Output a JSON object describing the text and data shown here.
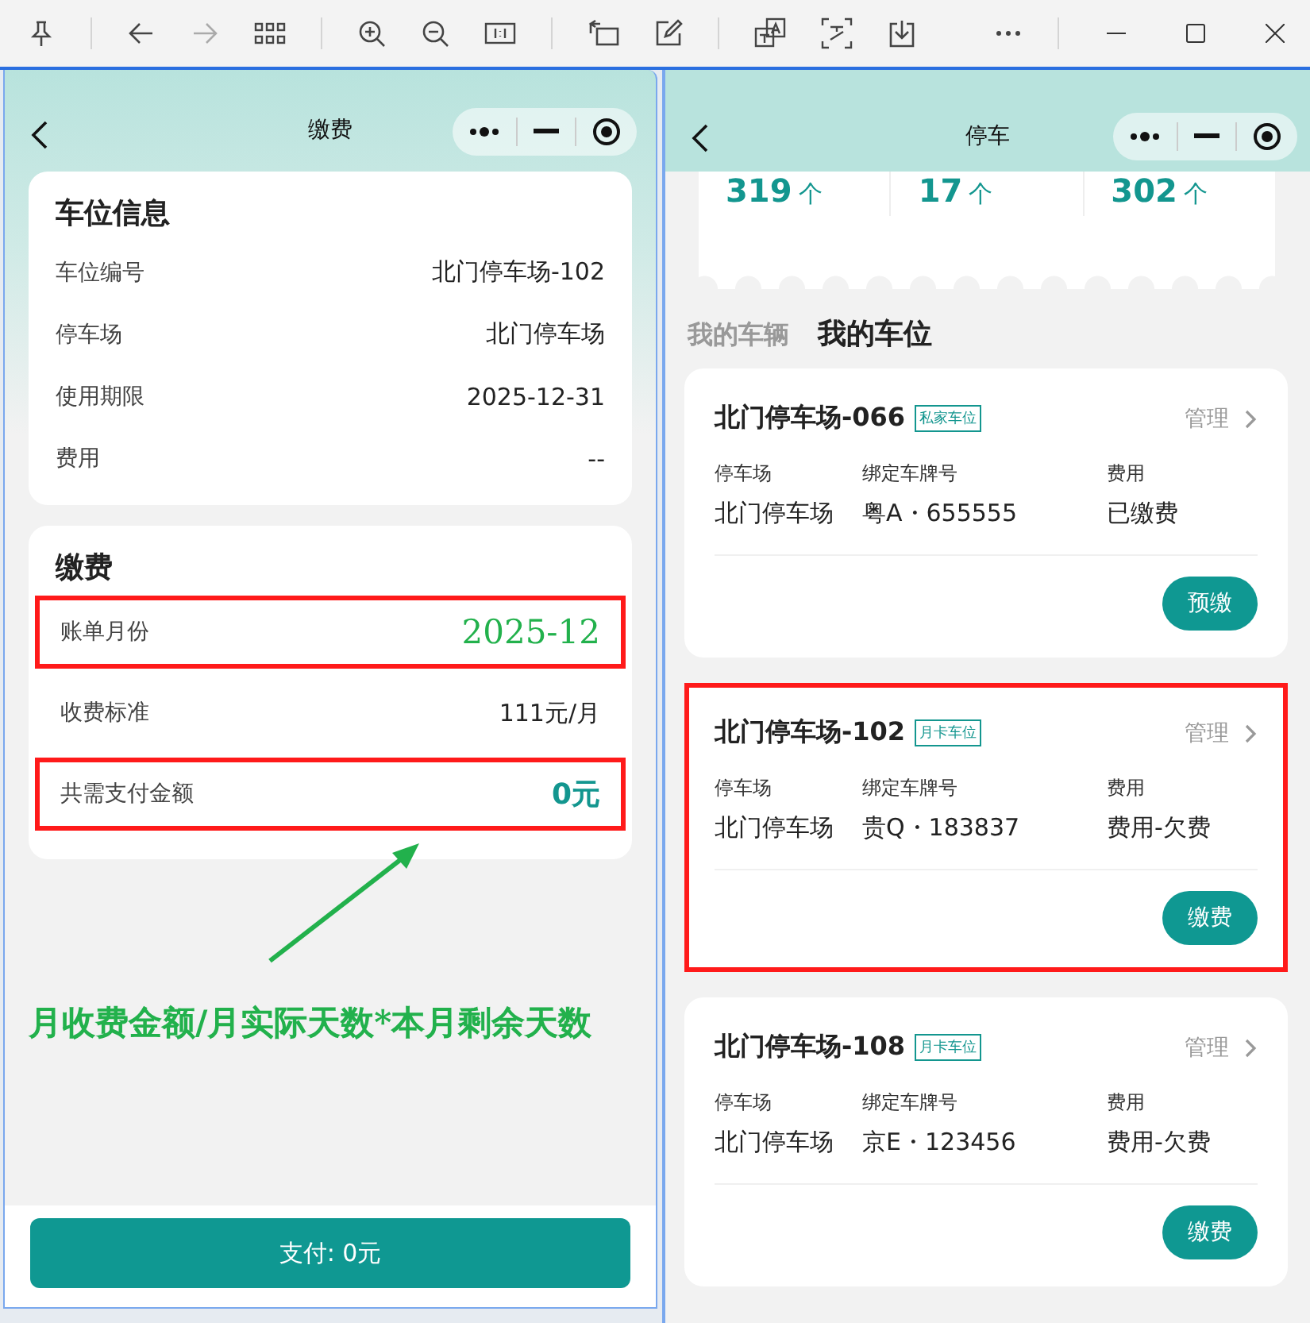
{
  "left": {
    "title": "缴费",
    "info_card": {
      "heading": "车位信息",
      "rows": [
        {
          "label": "车位编号",
          "value": "北门停车场-102"
        },
        {
          "label": "停车场",
          "value": "北门停车场"
        },
        {
          "label": "使用期限",
          "value": "2025-12-31"
        },
        {
          "label": "费用",
          "value": "--"
        }
      ]
    },
    "payment_card": {
      "heading": "缴费",
      "rows": [
        {
          "label": "账单月份",
          "value": "2025-12",
          "kind": "handwritten",
          "highlighted": true
        },
        {
          "label": "收费标准",
          "value": "111元/月",
          "kind": "plain",
          "highlighted": false
        },
        {
          "label": "共需支付金额",
          "value": "0元",
          "kind": "amount",
          "highlighted": true
        }
      ]
    },
    "pay_button": "支付: 0元"
  },
  "annotation_note": "月收费金额/月实际天数*本月剩余天数",
  "right": {
    "title": "停车",
    "stats": [
      {
        "value": "319",
        "unit": "个"
      },
      {
        "value": "17",
        "unit": "个"
      },
      {
        "value": "302",
        "unit": "个"
      }
    ],
    "tabs": [
      {
        "label": "我的车辆",
        "selected": false
      },
      {
        "label": "我的车位",
        "selected": true
      }
    ],
    "spaces": [
      {
        "name": "北门停车场-066",
        "tag": "私家车位",
        "manage": "管理",
        "fields": [
          {
            "label": "停车场",
            "value": "北门停车场"
          },
          {
            "label": "绑定车牌号",
            "value": "粤A・655555"
          },
          {
            "label": "费用",
            "value": "已缴费"
          }
        ],
        "action": "预缴",
        "highlighted": false
      },
      {
        "name": "北门停车场-102",
        "tag": "月卡车位",
        "manage": "管理",
        "fields": [
          {
            "label": "停车场",
            "value": "北门停车场"
          },
          {
            "label": "绑定车牌号",
            "value": "贵Q・183837"
          },
          {
            "label": "费用",
            "value": "费用-欠费"
          }
        ],
        "action": "缴费",
        "highlighted": true
      },
      {
        "name": "北门停车场-108",
        "tag": "月卡车位",
        "manage": "管理",
        "fields": [
          {
            "label": "停车场",
            "value": "北门停车场"
          },
          {
            "label": "绑定车牌号",
            "value": "京E・123456"
          },
          {
            "label": "费用",
            "value": "费用-欠费"
          }
        ],
        "action": "缴费",
        "highlighted": false
      }
    ]
  }
}
